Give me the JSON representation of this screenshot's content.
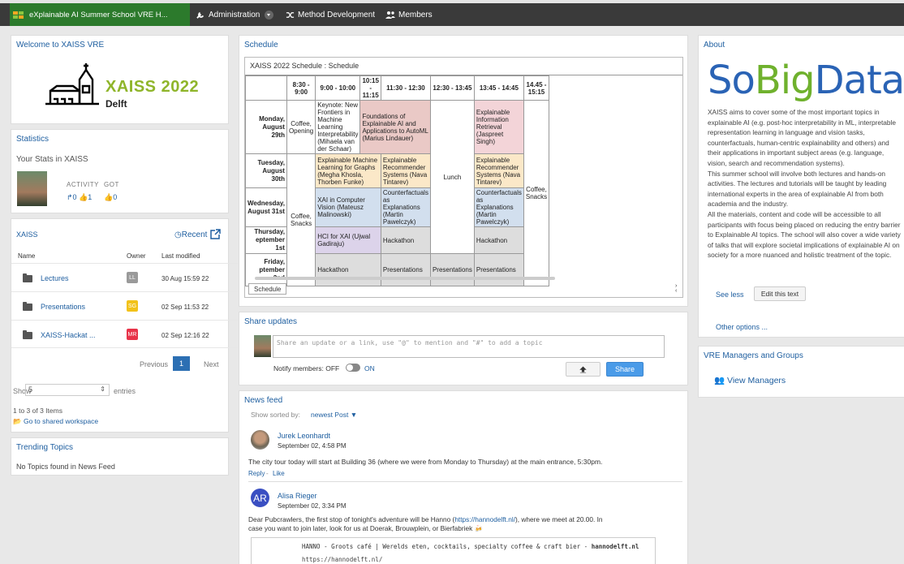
{
  "topbar": {
    "brand": "eXplainable AI Summer School VRE H...",
    "admin": "Administration",
    "method": "Method Development",
    "members": "Members"
  },
  "welcome": {
    "title": "Welcome to XAISS VRE",
    "logo_title": "XAISS 2022",
    "logo_sub": "Delft"
  },
  "stats": {
    "title": "Statistics",
    "subtitle": "Your Stats in XAISS",
    "activity_label": "ACTIVITY",
    "got_label": "GOT",
    "activity_values": "↱0 👍1",
    "got_values": "👍0"
  },
  "xaiss": {
    "title": "XAISS",
    "recent": "Recent",
    "columns": [
      "Name",
      "Owner",
      "Last modified"
    ],
    "rows": [
      {
        "name": "Lectures",
        "owner": "LL",
        "modified": "30 Aug 15:59 22",
        "color": "#9a9a9a"
      },
      {
        "name": "Presentations",
        "owner": "SG",
        "modified": "02 Sep 11:53 22",
        "color": "#f2c21a"
      },
      {
        "name": "XAISS-Hackat ...",
        "owner": "MR",
        "modified": "02 Sep 12:16 22",
        "color": "#e8344a"
      }
    ],
    "previous": "Previous",
    "page": "1",
    "next": "Next",
    "show": "Show",
    "show_value": "5",
    "entries": "entries",
    "count": "1 to 3 of 3 Items",
    "shared": "Go to shared workspace"
  },
  "trending": {
    "title": "Trending Topics",
    "empty": "No Topics found in News Feed"
  },
  "schedule": {
    "title": "Schedule",
    "caption": "XAISS 2022 Schedule : Schedule",
    "tab": "Schedule",
    "times": [
      "8:30 - 9:00",
      "9:00 - 10:00",
      "10:15 - 11:15",
      "11:30 - 12:30",
      "12:30 - 13:45",
      "13:45 - 14:45",
      "14.45 - 15:15"
    ],
    "days": [
      "Monday, August 29th",
      "Tuesday, August 30th",
      "Wednesday, August 31st",
      "Thursday, eptember 1st",
      "Friday, ptember 2nd"
    ],
    "coffee_opening": "Coffee, Opening",
    "coffee_snacks": "Coffee, Snacks",
    "keynote": "Keynote: New Frontiers in Machine Learning Interpretability (Mihaela van der Schaar)",
    "foundations": "Foundations of Explainable AI and Applications to AutoML (Marius Lindauer)",
    "xml_graphs": "Explainable Machine Learning for Graphs (Megha Khosla, Thorben Funke)",
    "recsys": "Explainable Recommender Systems (Nava Tintarev)",
    "cv": "XAI in Computer Vision (Mateusz Malinowski)",
    "counterfactuals": "Counterfactuals as Explanations (Martin Pawelczyk)",
    "hci": "HCI for XAI (Ujwal Gadiraju)",
    "hackathon": "Hackathon",
    "presentations": "Presentations",
    "lunch": "Lunch",
    "ir": "Explainable Information Retrieval (Jaspreet Singh)",
    "coffee_snacks2": "Coffee, Snacks"
  },
  "share": {
    "title": "Share updates",
    "placeholder": "Share an update or a link, use \"@\" to mention and \"#\" to add a topic",
    "notify": "Notify members: OFF",
    "on": "ON",
    "button": "Share"
  },
  "news": {
    "title": "News feed",
    "sorted": "Show sorted by:",
    "sort_value": "newest Post",
    "posts": [
      {
        "author": "Jurek Leonhardt",
        "date": "September 02, 4:58 PM",
        "text": "The city tour today will start at Building 36 (where we were from Monday to Thursday) at the main entrance, 5:30pm.",
        "reply": "Reply",
        "like": "Like"
      },
      {
        "author": "Alisa Rieger",
        "initials": "AR",
        "date": "September 02, 3:34 PM",
        "text_a": "Dear Pubcrawlers, the first stop of tonight's adventure will be Hanno (",
        "link": "https://hannodelft.nl/",
        "text_b": "), where we meet at 20.00. In",
        "text_c": "case you want to join later, look for us at Doerak, Brouwplein, or Bierfabriek 🍻",
        "preview_title": "HANNO - Groots café | Werelds eten, cocktails, specialty coffee & craft bier - ",
        "preview_domain": "hannodelft.nl",
        "preview_url": "https://hannodelft.nl/"
      }
    ]
  },
  "about": {
    "title": "About",
    "logo": {
      "a": "So",
      "b": "Big",
      "c": "Data"
    },
    "p1": "XAISS aims to cover some of the most important topics in explainable AI (e.g. post-hoc interpretability in ML, interpretable representation learning in language and vision tasks, counterfactuals, human-centric explainability and others) and their applications in important subject areas (e.g. language, vision, search and recommendation systems).",
    "p2": "This summer school will involve both lectures and hands-on activities. The lectures and tutorials will be taught by leading international experts in the area of explainable AI from both academia and the industry.",
    "p3": "All the materials, content and code will be accessible to all participants with focus being placed on reducing the entry barrier to Explainable AI topics. The school will also cover a wide variety of talks that will explore societal implications of explainable AI on society for a more nuanced and holistic treatment of the topic.",
    "see_less": "See less",
    "edit": "Edit this text",
    "other": "Other options ..."
  },
  "managers": {
    "title": "VRE Managers and Groups",
    "view": "View Managers"
  },
  "colors": {
    "topbar": "#3a3a3a",
    "brand": "#2c7a2c",
    "link": "#1f5fa0",
    "share_button": "#4a9be8",
    "sobig_blue": "#2a63b5",
    "sobig_green": "#6fb12d"
  }
}
